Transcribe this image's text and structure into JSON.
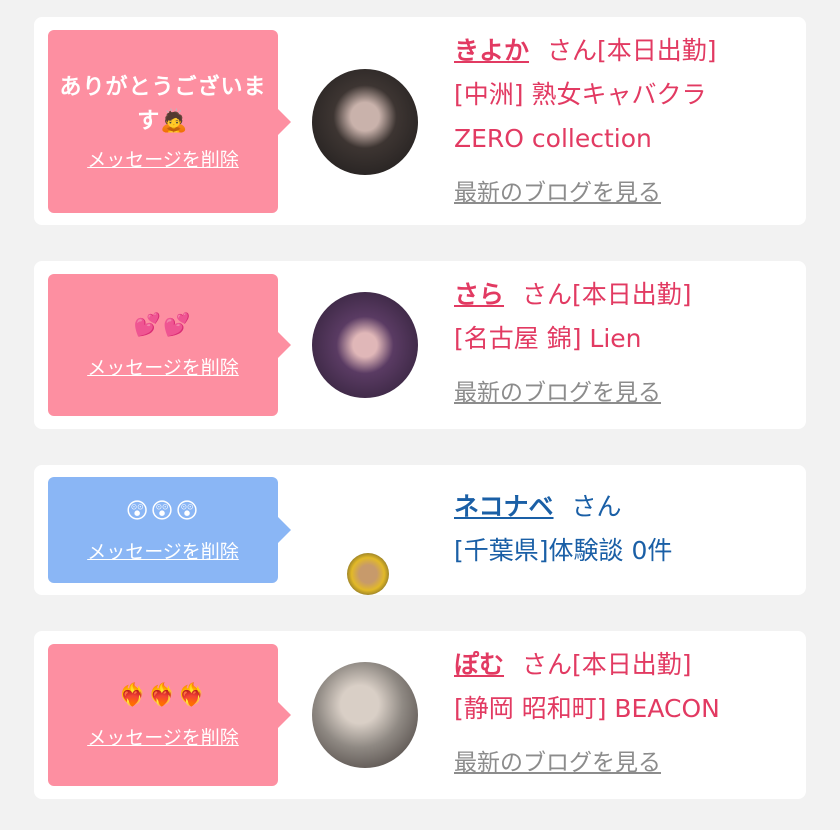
{
  "items": [
    {
      "message": "ありがとうございます🙇",
      "delete_label": "メッセージを削除",
      "name": "きよか",
      "honorific": "さん",
      "tag": "[本日出勤]",
      "shop": "[中洲] 熟女キャバクラ",
      "shop2": "ZERO collection",
      "blog_label": "最新のブログを見る",
      "bubble_color": "#fd8fa1"
    },
    {
      "message": "💕💕",
      "delete_label": "メッセージを削除",
      "name": "さら",
      "honorific": "さん",
      "tag": "[本日出勤]",
      "shop": "[名古屋 錦] Lien",
      "blog_label": "最新のブログを見る",
      "bubble_color": "#fd8fa1"
    },
    {
      "message": "😲😲😲",
      "delete_label": "メッセージを削除",
      "name": "ネコナベ",
      "honorific": "さん",
      "shop": "[千葉県]体験談 0件",
      "bubble_color": "#8ab6f5"
    },
    {
      "message": "❤️‍🔥❤️‍🔥❤️‍🔥",
      "delete_label": "メッセージを削除",
      "name": "ぽむ",
      "honorific": "さん",
      "tag": "[本日出勤]",
      "shop": "[静岡 昭和町] BEACON",
      "blog_label": "最新のブログを見る",
      "bubble_color": "#fd8fa1"
    }
  ],
  "colors": {
    "background": "#f2f2f2",
    "accent_pink": "#e23a62",
    "accent_blue": "#1a5fa6",
    "link_gray": "#8c8c8c"
  }
}
